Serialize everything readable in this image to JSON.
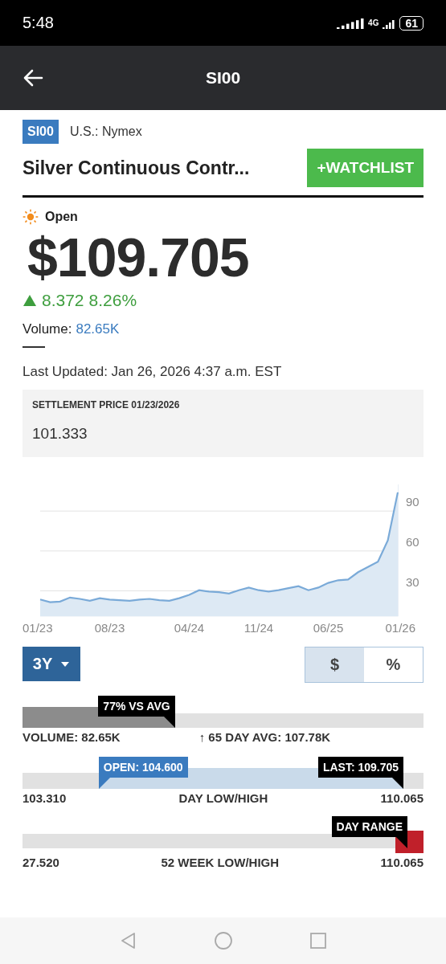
{
  "status_bar": {
    "time": "5:48",
    "battery": "61",
    "network": "4G"
  },
  "app_bar": {
    "title": "SI00"
  },
  "header": {
    "symbol": "SI00",
    "exchange": "U.S.: Nymex",
    "name": "Silver Continuous Contr...",
    "watchlist_button": "+WATCHLIST"
  },
  "quote": {
    "market_status": "Open",
    "price": "$109.705",
    "change": "8.372",
    "change_percent": "8.26%",
    "volume_label": "Volume:",
    "volume_value": "82.65K",
    "last_updated": "Last Updated: Jan 26, 2026 4:37 a.m. EST"
  },
  "settlement": {
    "label": "SETTLEMENT PRICE 01/23/2026",
    "value": "101.333"
  },
  "chart": {
    "chart_data": {
      "type": "area",
      "categories": [
        "01/23",
        null,
        null,
        null,
        null,
        null,
        null,
        "08/23",
        null,
        null,
        null,
        null,
        null,
        null,
        null,
        "04/24",
        null,
        null,
        null,
        null,
        null,
        null,
        "11/24",
        null,
        null,
        null,
        null,
        null,
        null,
        "06/25",
        null,
        null,
        null,
        null,
        null,
        null,
        "01/26"
      ],
      "series": [
        {
          "color": "#7aaad8",
          "values": [
            23.5,
            21.5,
            22,
            25,
            24,
            22.5,
            24.5,
            23.5,
            23,
            22.5,
            23.5,
            24,
            23,
            22.5,
            24.5,
            27,
            30.5,
            29.5,
            29,
            28,
            30.5,
            32.5,
            30.5,
            29.5,
            30.5,
            32,
            33.5,
            30.5,
            32.5,
            36,
            38,
            38.5,
            44,
            48,
            52,
            68,
            104
          ]
        }
      ],
      "ylim": [
        11,
        110
      ],
      "grid": true,
      "yticks": [
        30,
        60,
        90
      ]
    },
    "period": "3Y",
    "modes": [
      {
        "label": "$",
        "selected": true
      },
      {
        "label": "%",
        "selected": false
      }
    ]
  },
  "volume_bar": {
    "level": 0.38,
    "tag": "77% VS AVG",
    "left_label": "VOLUME: 82.65K",
    "right_label": "↑ 65 DAY AVG: 107.78K"
  },
  "day_range": {
    "open_label": "OPEN: 104.600",
    "last_label": "LAST: 109.705",
    "low": "103.310",
    "title": "DAY LOW/HIGH",
    "high": "110.065"
  },
  "week52_range": {
    "marker_label": "DAY RANGE",
    "low": "27.520",
    "title": "52 WEEK LOW/HIGH",
    "high": "110.065"
  }
}
